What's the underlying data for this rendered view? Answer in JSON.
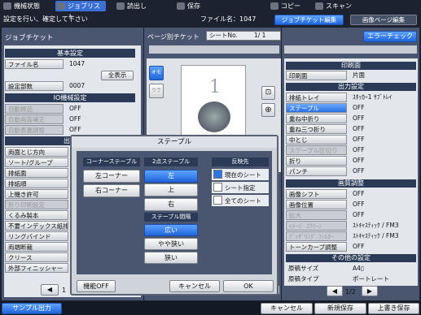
{
  "top_tabs": [
    "機械状態",
    "ジョブリスト",
    "読出し",
    "保存",
    "コピー",
    "スキャン"
  ],
  "instruction": "設定を行い、確定して下さい",
  "file_name_display": "ファイル名：1047",
  "sub_tabs": [
    "ジョブチケット編集",
    "画像ページ編集"
  ],
  "left_title": "ジョブチケット",
  "basic": {
    "header": "基本設定",
    "rows": [
      {
        "label": "ファイル名",
        "value": "1047"
      },
      {
        "label": "設定部数",
        "value": "0007"
      }
    ],
    "show_all": "全表示"
  },
  "io": {
    "header": "IO機械設定",
    "rows": [
      {
        "label": "自動検品",
        "value": "OFF"
      },
      {
        "label": "自動画質補正",
        "value": "OFF"
      },
      {
        "label": "自動表裏調整",
        "value": "OFF"
      }
    ]
  },
  "output_partial": "出力",
  "left_rows": [
    "両面とじ方向",
    "ソート/グループ",
    "排紙面",
    "排紙順",
    "上機き許可",
    "折り印刷設定",
    "くるみ製本",
    "不要インデックス紙排紙",
    "リングバインド",
    "両端断裁",
    "クリース",
    "外部フィニッシャー"
  ],
  "left_page": "1",
  "mid_title": "ページ別チケット",
  "sheet_label": "シートNo.",
  "sheet_value": "1/  1",
  "error_check": "エラーチェック",
  "thumb_labels": {
    "front": "オモテ",
    "back": "ウラ",
    "page_number": "1"
  },
  "print_side": {
    "header": "印刷面",
    "label": "印刷面",
    "value": "片面"
  },
  "output": {
    "header": "出力設定",
    "rows": [
      {
        "label": "排紙トレイ",
        "value": "ｽﾀｯｶｰ1 ｻﾌﾞﾄﾚｲ",
        "state": "normal"
      },
      {
        "label": "ステープル",
        "value": "OFF",
        "state": "active"
      },
      {
        "label": "重ね中折り",
        "value": "OFF",
        "state": "normal"
      },
      {
        "label": "重ね三つ折り",
        "value": "OFF",
        "state": "normal"
      },
      {
        "label": "中とじ",
        "value": "OFF",
        "state": "normal"
      },
      {
        "label": "ステープル区切り",
        "value": "OFF",
        "state": "disabled"
      },
      {
        "label": "折り",
        "value": "OFF",
        "state": "normal"
      },
      {
        "label": "パンチ",
        "value": "OFF",
        "state": "normal"
      }
    ]
  },
  "image": {
    "header": "画質調整",
    "rows": [
      {
        "label": "画像シフト",
        "value": "OFF",
        "state": "normal"
      },
      {
        "label": "画像位置",
        "value": "OFF",
        "state": "normal"
      },
      {
        "label": "拡大",
        "value": "OFF",
        "state": "disabled"
      },
      {
        "label": "ｲﾒｰｼﾞ ｽｸﾘｰﾝ",
        "value": "ｽﾄｷｬｽﾃｨｯｸ / FM3",
        "state": "disabled"
      },
      {
        "label": "ﾃﾞｨｻﾞﾘﾝｸﾞ ﾌｨﾙﾀｰ",
        "value": "ｽﾄｷｬｽﾃｨｯｸ / FM3",
        "state": "disabled"
      },
      {
        "label": "トーンカーブ調整",
        "value": "OFF",
        "state": "normal"
      }
    ]
  },
  "other": {
    "header": "その他の設定",
    "rows": [
      {
        "label": "原稿サイズ",
        "value": "A4▯"
      },
      {
        "label": "原稿タイプ",
        "value": "ポートレート"
      }
    ]
  },
  "right_page": "1/2",
  "dialog": {
    "title": "ステープル",
    "corner": {
      "header": "コーナーステープル",
      "left": "左コーナー",
      "right": "右コーナー"
    },
    "two_point": {
      "header": "2点ステープル",
      "left": "左",
      "top": "上",
      "right": "右"
    },
    "interval": {
      "header": "ステープル間隔",
      "wide": "広い",
      "slightly": "やや狭い",
      "narrow": "狭い"
    },
    "reflect": {
      "header": "反映先",
      "current": "現在のシート",
      "sheet_spec": "シート指定",
      "all": "全てのシート"
    },
    "func_off": "機能OFF",
    "cancel": "キャンセル",
    "ok": "OK"
  },
  "bottom": {
    "sample": "サンプル出力",
    "cancel": "キャンセル",
    "new_save": "新規保存",
    "overwrite": "上書き保存"
  }
}
